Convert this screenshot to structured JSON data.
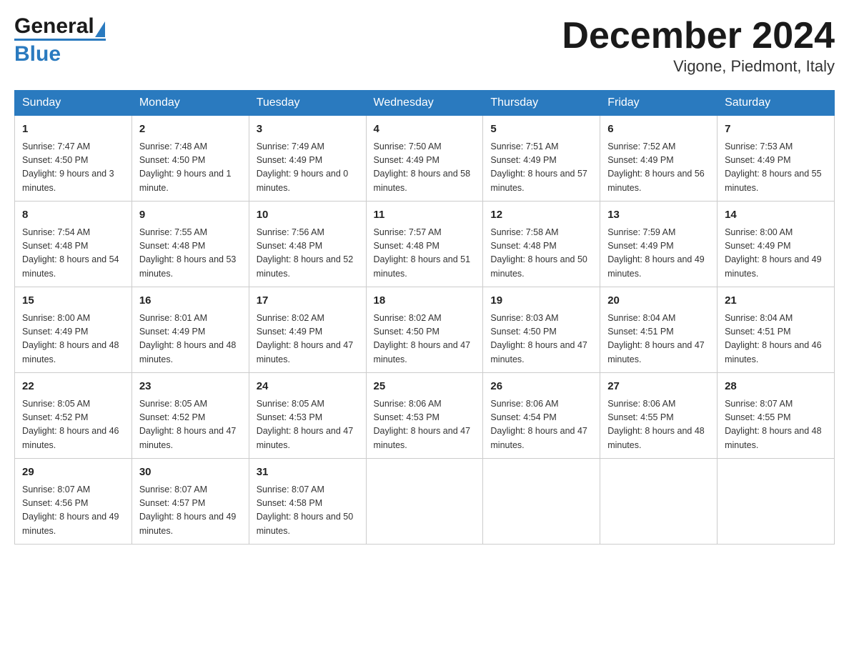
{
  "header": {
    "month_year": "December 2024",
    "location": "Vigone, Piedmont, Italy"
  },
  "days_of_week": [
    "Sunday",
    "Monday",
    "Tuesday",
    "Wednesday",
    "Thursday",
    "Friday",
    "Saturday"
  ],
  "weeks": [
    [
      {
        "day": "1",
        "sunrise": "7:47 AM",
        "sunset": "4:50 PM",
        "daylight": "9 hours and 3 minutes."
      },
      {
        "day": "2",
        "sunrise": "7:48 AM",
        "sunset": "4:50 PM",
        "daylight": "9 hours and 1 minute."
      },
      {
        "day": "3",
        "sunrise": "7:49 AM",
        "sunset": "4:49 PM",
        "daylight": "9 hours and 0 minutes."
      },
      {
        "day": "4",
        "sunrise": "7:50 AM",
        "sunset": "4:49 PM",
        "daylight": "8 hours and 58 minutes."
      },
      {
        "day": "5",
        "sunrise": "7:51 AM",
        "sunset": "4:49 PM",
        "daylight": "8 hours and 57 minutes."
      },
      {
        "day": "6",
        "sunrise": "7:52 AM",
        "sunset": "4:49 PM",
        "daylight": "8 hours and 56 minutes."
      },
      {
        "day": "7",
        "sunrise": "7:53 AM",
        "sunset": "4:49 PM",
        "daylight": "8 hours and 55 minutes."
      }
    ],
    [
      {
        "day": "8",
        "sunrise": "7:54 AM",
        "sunset": "4:48 PM",
        "daylight": "8 hours and 54 minutes."
      },
      {
        "day": "9",
        "sunrise": "7:55 AM",
        "sunset": "4:48 PM",
        "daylight": "8 hours and 53 minutes."
      },
      {
        "day": "10",
        "sunrise": "7:56 AM",
        "sunset": "4:48 PM",
        "daylight": "8 hours and 52 minutes."
      },
      {
        "day": "11",
        "sunrise": "7:57 AM",
        "sunset": "4:48 PM",
        "daylight": "8 hours and 51 minutes."
      },
      {
        "day": "12",
        "sunrise": "7:58 AM",
        "sunset": "4:48 PM",
        "daylight": "8 hours and 50 minutes."
      },
      {
        "day": "13",
        "sunrise": "7:59 AM",
        "sunset": "4:49 PM",
        "daylight": "8 hours and 49 minutes."
      },
      {
        "day": "14",
        "sunrise": "8:00 AM",
        "sunset": "4:49 PM",
        "daylight": "8 hours and 49 minutes."
      }
    ],
    [
      {
        "day": "15",
        "sunrise": "8:00 AM",
        "sunset": "4:49 PM",
        "daylight": "8 hours and 48 minutes."
      },
      {
        "day": "16",
        "sunrise": "8:01 AM",
        "sunset": "4:49 PM",
        "daylight": "8 hours and 48 minutes."
      },
      {
        "day": "17",
        "sunrise": "8:02 AM",
        "sunset": "4:49 PM",
        "daylight": "8 hours and 47 minutes."
      },
      {
        "day": "18",
        "sunrise": "8:02 AM",
        "sunset": "4:50 PM",
        "daylight": "8 hours and 47 minutes."
      },
      {
        "day": "19",
        "sunrise": "8:03 AM",
        "sunset": "4:50 PM",
        "daylight": "8 hours and 47 minutes."
      },
      {
        "day": "20",
        "sunrise": "8:04 AM",
        "sunset": "4:51 PM",
        "daylight": "8 hours and 47 minutes."
      },
      {
        "day": "21",
        "sunrise": "8:04 AM",
        "sunset": "4:51 PM",
        "daylight": "8 hours and 46 minutes."
      }
    ],
    [
      {
        "day": "22",
        "sunrise": "8:05 AM",
        "sunset": "4:52 PM",
        "daylight": "8 hours and 46 minutes."
      },
      {
        "day": "23",
        "sunrise": "8:05 AM",
        "sunset": "4:52 PM",
        "daylight": "8 hours and 47 minutes."
      },
      {
        "day": "24",
        "sunrise": "8:05 AM",
        "sunset": "4:53 PM",
        "daylight": "8 hours and 47 minutes."
      },
      {
        "day": "25",
        "sunrise": "8:06 AM",
        "sunset": "4:53 PM",
        "daylight": "8 hours and 47 minutes."
      },
      {
        "day": "26",
        "sunrise": "8:06 AM",
        "sunset": "4:54 PM",
        "daylight": "8 hours and 47 minutes."
      },
      {
        "day": "27",
        "sunrise": "8:06 AM",
        "sunset": "4:55 PM",
        "daylight": "8 hours and 48 minutes."
      },
      {
        "day": "28",
        "sunrise": "8:07 AM",
        "sunset": "4:55 PM",
        "daylight": "8 hours and 48 minutes."
      }
    ],
    [
      {
        "day": "29",
        "sunrise": "8:07 AM",
        "sunset": "4:56 PM",
        "daylight": "8 hours and 49 minutes."
      },
      {
        "day": "30",
        "sunrise": "8:07 AM",
        "sunset": "4:57 PM",
        "daylight": "8 hours and 49 minutes."
      },
      {
        "day": "31",
        "sunrise": "8:07 AM",
        "sunset": "4:58 PM",
        "daylight": "8 hours and 50 minutes."
      },
      null,
      null,
      null,
      null
    ]
  ],
  "labels": {
    "sunrise": "Sunrise:",
    "sunset": "Sunset:",
    "daylight": "Daylight:"
  }
}
